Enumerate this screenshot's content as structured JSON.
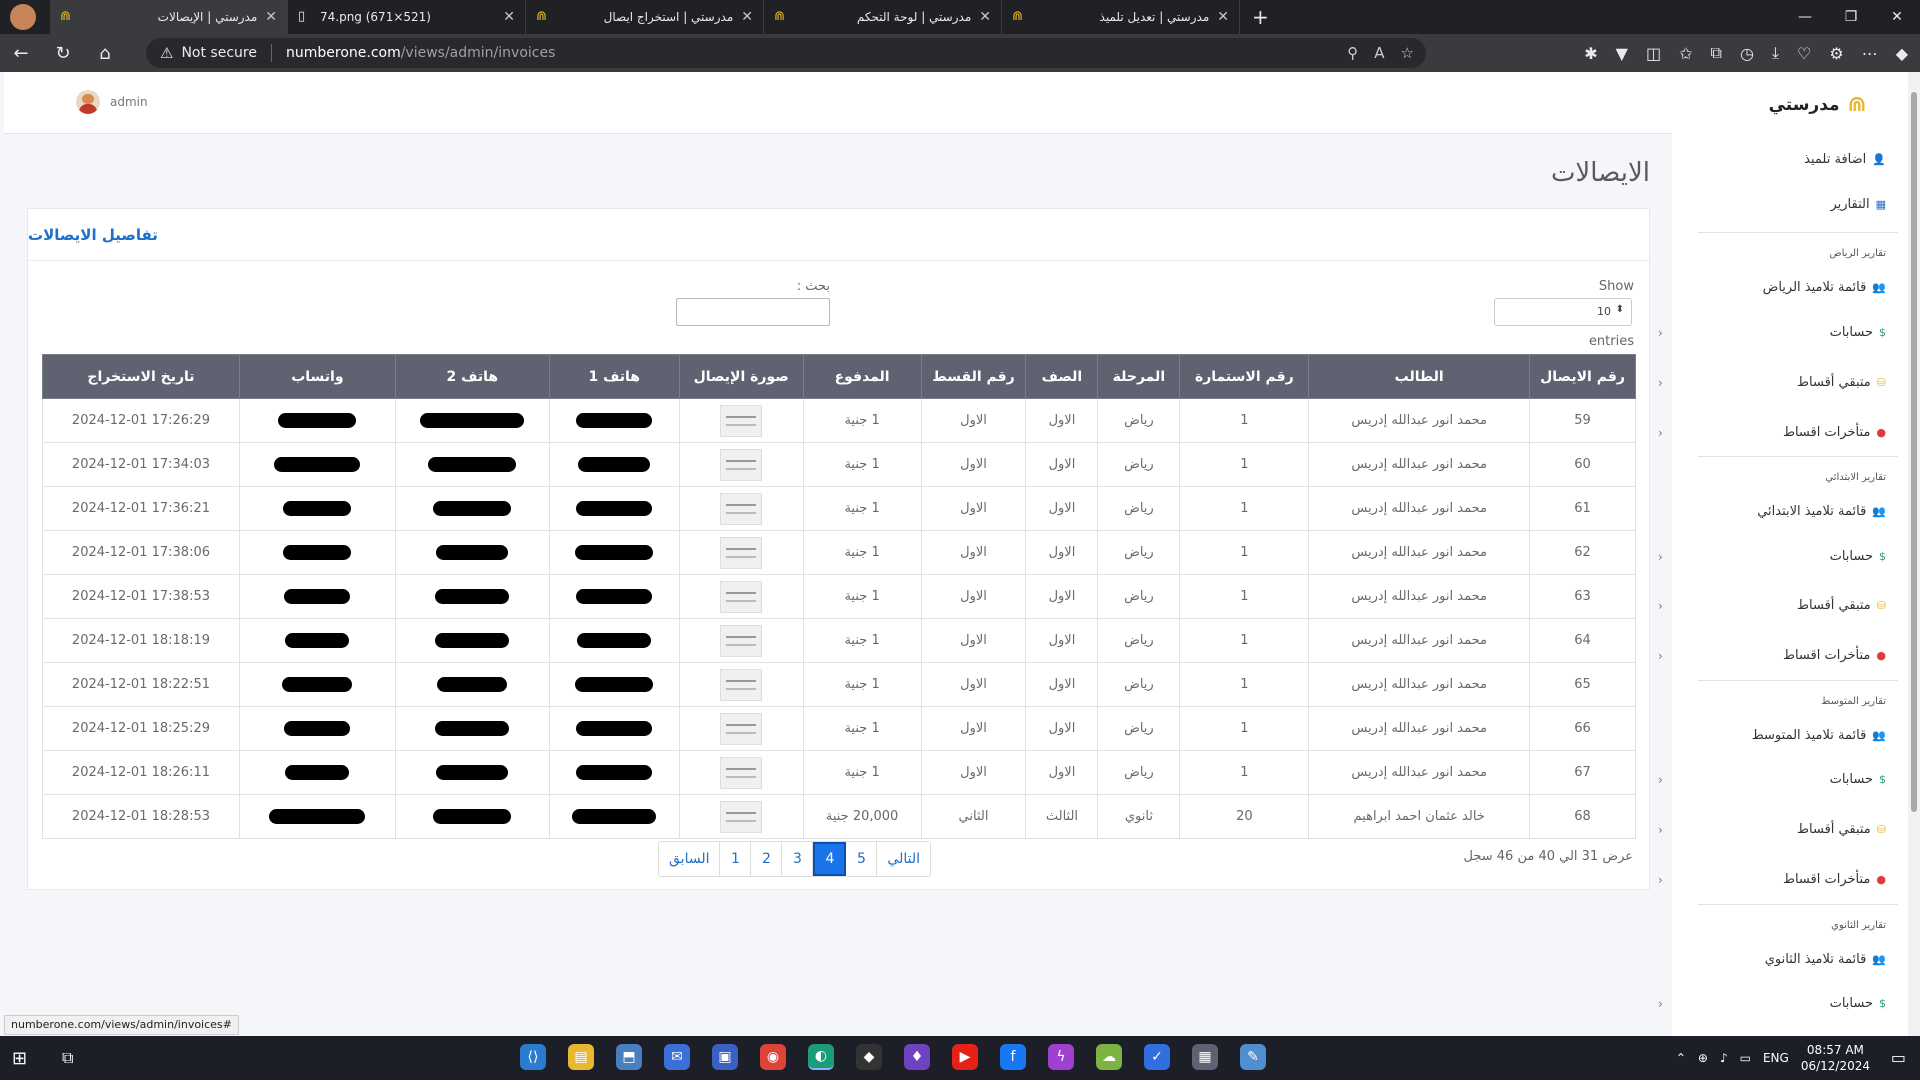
{
  "browser": {
    "tabs": [
      {
        "title": "مدرستي | الإيصالات",
        "type": "school",
        "active": true
      },
      {
        "title": "74.png (671×521)",
        "type": "doc",
        "active": false
      },
      {
        "title": "مدرستي | استخراج ايصال",
        "type": "school",
        "active": false
      },
      {
        "title": "مدرستي | لوحة التحكم",
        "type": "school",
        "active": false
      },
      {
        "title": "مدرستي | تعديل تلميذ",
        "type": "school",
        "active": false
      }
    ],
    "security_label": "Not secure",
    "url_host": "numberone.com",
    "url_path": "/views/admin/invoices"
  },
  "topbar": {
    "username": "admin"
  },
  "page": {
    "title": "الايصالات",
    "card_title": "تفاصيل الايصالات"
  },
  "controls": {
    "show_label": "Show",
    "show_value": "10",
    "entries_label": "entries",
    "search_label": "بحث :"
  },
  "table": {
    "columns": [
      "رقم الايصال",
      "الطالب",
      "رقم الاستمارة",
      "المرحلة",
      "الصف",
      "رقم القسط",
      "المدفوع",
      "صورة الإيصال",
      "هاتف 1",
      "هاتف 2",
      "واتساب",
      "تاريخ الاستخراج"
    ],
    "rows": [
      {
        "id": "59",
        "student": "محمد انور عبدالله إدريس",
        "form": "1",
        "stage": "رياض",
        "grade": "الاول",
        "installment": "الاول",
        "paid": "1 جنية",
        "date": "2024-12-01 17:26:29"
      },
      {
        "id": "60",
        "student": "محمد انور عبدالله إدريس",
        "form": "1",
        "stage": "رياض",
        "grade": "الاول",
        "installment": "الاول",
        "paid": "1 جنية",
        "date": "2024-12-01 17:34:03"
      },
      {
        "id": "61",
        "student": "محمد انور عبدالله إدريس",
        "form": "1",
        "stage": "رياض",
        "grade": "الاول",
        "installment": "الاول",
        "paid": "1 جنية",
        "date": "2024-12-01 17:36:21"
      },
      {
        "id": "62",
        "student": "محمد انور عبدالله إدريس",
        "form": "1",
        "stage": "رياض",
        "grade": "الاول",
        "installment": "الاول",
        "paid": "1 جنية",
        "date": "2024-12-01 17:38:06"
      },
      {
        "id": "63",
        "student": "محمد انور عبدالله إدريس",
        "form": "1",
        "stage": "رياض",
        "grade": "الاول",
        "installment": "الاول",
        "paid": "1 جنية",
        "date": "2024-12-01 17:38:53"
      },
      {
        "id": "64",
        "student": "محمد انور عبدالله إدريس",
        "form": "1",
        "stage": "رياض",
        "grade": "الاول",
        "installment": "الاول",
        "paid": "1 جنية",
        "date": "2024-12-01 18:18:19"
      },
      {
        "id": "65",
        "student": "محمد انور عبدالله إدريس",
        "form": "1",
        "stage": "رياض",
        "grade": "الاول",
        "installment": "الاول",
        "paid": "1 جنية",
        "date": "2024-12-01 18:22:51"
      },
      {
        "id": "66",
        "student": "محمد انور عبدالله إدريس",
        "form": "1",
        "stage": "رياض",
        "grade": "الاول",
        "installment": "الاول",
        "paid": "1 جنية",
        "date": "2024-12-01 18:25:29"
      },
      {
        "id": "67",
        "student": "محمد انور عبدالله إدريس",
        "form": "1",
        "stage": "رياض",
        "grade": "الاول",
        "installment": "الاول",
        "paid": "1 جنية",
        "date": "2024-12-01 18:26:11"
      },
      {
        "id": "68",
        "student": "خالد عثمان احمد ابراهيم",
        "form": "20",
        "stage": "ثانوي",
        "grade": "الثالث",
        "installment": "الثاني",
        "paid": "20,000 جنية",
        "date": "2024-12-01 18:28:53"
      }
    ]
  },
  "pagination": {
    "info": "عرض 31 الي 40 من 46 سجل",
    "prev_label": "السابق",
    "next_label": "التالي",
    "pages": [
      "1",
      "2",
      "3",
      "4",
      "5"
    ],
    "current": "4"
  },
  "sidebar": {
    "brand": "مدرستي",
    "top_items": [
      "اضافة تلميذ",
      "التقارير"
    ],
    "sections": [
      {
        "heading": "تقارير الرياض",
        "list_label": "قائمة تلاميذ الرياض"
      },
      {
        "heading": "تقارير الابتدائي",
        "list_label": "قائمة تلاميذ الابتدائي"
      },
      {
        "heading": "تقارير المتوسط",
        "list_label": "قائمة تلاميذ المتوسط"
      },
      {
        "heading": "تقارير الثانوي",
        "list_label": "قائمة تلاميذ الثانوي"
      }
    ],
    "accounts_label": "حسابات",
    "remaining_label": "متبقي أقساط",
    "overdue_label": "متأخرات اقساط"
  },
  "statusbar": {
    "url": "numberone.com/views/admin/invoices#"
  },
  "taskbar": {
    "lang": "ENG",
    "time": "08:57 AM",
    "date": "06/12/2024"
  },
  "colors": {
    "accent": "#1a73e8",
    "table_header": "#5f6270",
    "brand_gold": "#e8b830"
  }
}
